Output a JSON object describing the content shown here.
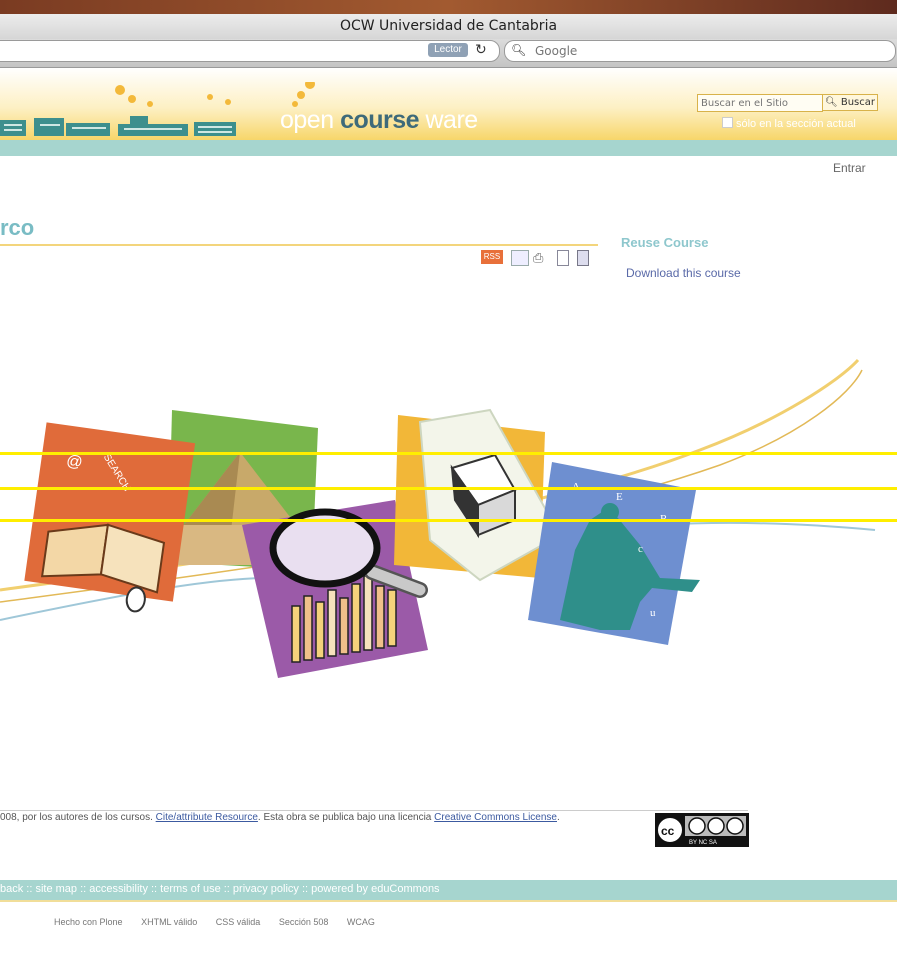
{
  "browser": {
    "window_title": "OCW Universidad de Cantabria",
    "reader_label": "Lector",
    "search_placeholder": "Google"
  },
  "header": {
    "logo_light_1": "open ",
    "logo_bold": "course",
    "logo_light_2": " ware",
    "search_placeholder": "Buscar en el Sitio",
    "search_button": "Buscar",
    "only_section_label": "sólo en la sección actual"
  },
  "nav": {
    "login_link": "Entrar"
  },
  "page": {
    "title_fragment": "rco",
    "doc_actions": [
      "RSS",
      "email",
      "print",
      "document",
      "bookmark"
    ]
  },
  "sidebar": {
    "heading": "Reuse Course",
    "download_link": "Download this course"
  },
  "illustration": {
    "search_word": "SEARCH",
    "at_symbol": "@",
    "letters": [
      "A",
      "E",
      "R",
      "c",
      "u"
    ]
  },
  "footer": {
    "copyright_prefix": "008, por los autores de los cursos. ",
    "cite_link": "Cite/attribute Resource",
    "copyright_middle": ". Esta obra se publica bajo una licencia ",
    "license_link": "Creative Commons License",
    "copyright_suffix": ".",
    "cc_badge_text": "BY  NC  SA",
    "links_bar": "back :: site map :: accessibility :: terms of use :: privacy policy :: powered by eduCommons",
    "badges": [
      "Hecho con Plone",
      "XHTML válido",
      "CSS válida",
      "Sección 508",
      "WCAG"
    ]
  },
  "colors": {
    "teal": "#a6d5cf",
    "title_teal": "#79bcc4",
    "link_blue": "#5a6aa8",
    "header_gold": "#f7d66a",
    "annotation_yellow": "#ffee00"
  }
}
